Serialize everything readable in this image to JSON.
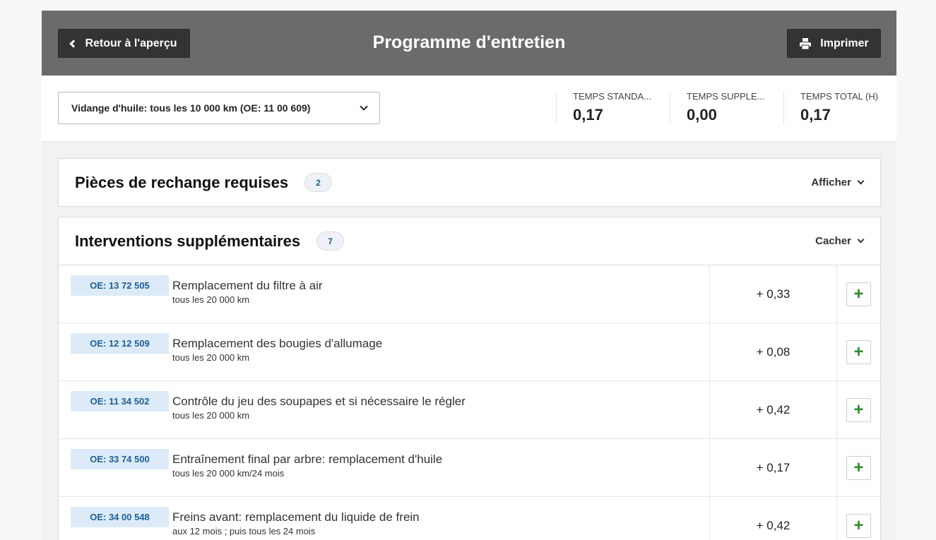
{
  "header": {
    "back_label": "Retour à l'aperçu",
    "title": "Programme d'entretien",
    "print_label": "Imprimer"
  },
  "toolbar": {
    "selected_service": "Vidange d'huile: tous les 10 000 km (OE: 11 00 609)",
    "stats": [
      {
        "label": "TEMPS STANDA...",
        "value": "0,17"
      },
      {
        "label": "TEMPS SUPPLE...",
        "value": "0,00"
      },
      {
        "label": "TEMPS TOTAL (H)",
        "value": "0,17"
      }
    ]
  },
  "parts_panel": {
    "title": "Pièces de rechange requises",
    "count": "2",
    "toggle_label": "Afficher"
  },
  "interventions_panel": {
    "title": "Interventions supplémentaires",
    "count": "7",
    "toggle_label": "Cacher",
    "rows": [
      {
        "oe": "OE: 13 72 505",
        "title": "Remplacement du filtre à air",
        "sub": "tous les 20 000 km",
        "time": "+ 0,33",
        "add": "+"
      },
      {
        "oe": "OE: 12 12 509",
        "title": "Remplacement des bougies d'allumage",
        "sub": "tous les 20 000 km",
        "time": "+ 0,08",
        "add": "+"
      },
      {
        "oe": "OE: 11 34 502",
        "title": "Contrôle du jeu des soupapes et si nécessaire le régler",
        "sub": "tous les 20 000 km",
        "time": "+ 0,42",
        "add": "+"
      },
      {
        "oe": "OE: 33 74 500",
        "title": "Entraînement final par arbre: remplacement d'huile",
        "sub": "tous les 20 000 km/24 mois",
        "time": "+ 0,17",
        "add": "+"
      },
      {
        "oe": "OE: 34 00 548",
        "title": "Freins avant: remplacement du liquide de frein",
        "sub": "aux 12 mois ; puis tous les 24 mois",
        "time": "+ 0,42",
        "add": "+"
      }
    ]
  },
  "colors": {
    "header_bg": "#6b6b6b",
    "button_bg": "#333333",
    "oe_badge_bg": "#dcebf7",
    "oe_badge_text": "#1d5f95",
    "add_icon": "#2e8b2e"
  }
}
